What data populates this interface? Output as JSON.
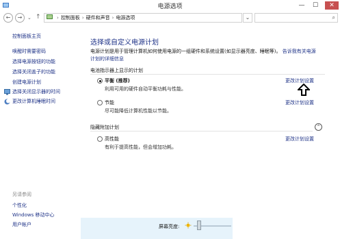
{
  "window": {
    "title": "电源选项",
    "min": "—",
    "max": "☐",
    "close": "✕"
  },
  "address": {
    "back": "←",
    "forward": "→",
    "dropdown": "⌄",
    "up": "↑",
    "crumbs": [
      "控制面板",
      "硬件和声音",
      "电源选项"
    ],
    "separator": "›",
    "refresh": "⌄",
    "search_icon": "⌕"
  },
  "sidebar": {
    "home": "控制面板主页",
    "links": [
      "唤醒时需要密码",
      "选择电源按钮的功能",
      "选择关闭盖子的功能",
      "创建电源计划",
      "选择关闭显示器的时间",
      "更改计算机睡眠时间"
    ],
    "see_also": "另请参阅",
    "see_also_links": [
      "个性化",
      "Windows 移动中心",
      "用户帐户"
    ]
  },
  "main": {
    "title": "选择或自定义电源计划",
    "desc_text": "电源计划是用于管理计算机如何使用电源的一组硬件和系统设置(如显示器亮度、睡眠等)。",
    "desc_link": "告诉我有关电源计划的详细信息",
    "group1_label": "电池指示器上显示的计划",
    "plans": [
      {
        "name": "平衡 (推荐)",
        "desc": "利用可用的硬件自动平衡功耗与性能。",
        "selected": true,
        "change": "更改计划设置"
      },
      {
        "name": "节能",
        "desc": "尽可能降低计算机性能以节能。",
        "selected": false,
        "change": "更改计划设置"
      }
    ],
    "group2_label": "隐藏附加计划",
    "collapse": "⌃",
    "extra_plans": [
      {
        "name": "高性能",
        "desc": "有利于提高性能，但会增加功耗。",
        "selected": false,
        "change": "更改计划设置"
      }
    ]
  },
  "bottom": {
    "brightness_label": "屏幕亮度:",
    "brightness_level": 0.15
  },
  "colors": {
    "link": "#1e3287",
    "close_button": "#c75050",
    "bottom_bar": "#e6f3fb"
  }
}
